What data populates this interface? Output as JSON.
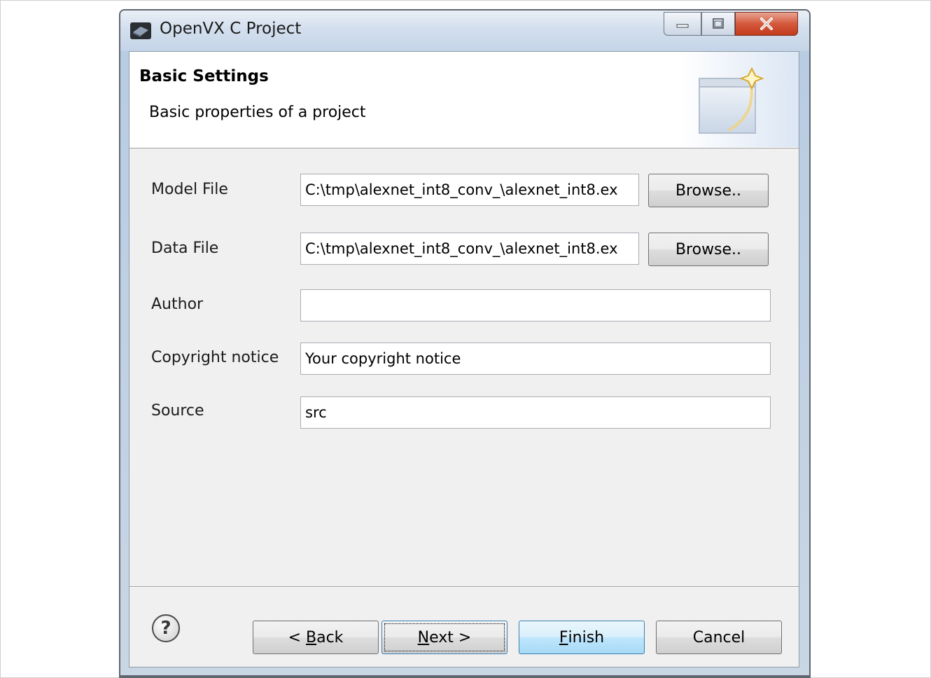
{
  "window": {
    "title": "OpenVX C Project"
  },
  "banner": {
    "title": "Basic Settings",
    "subtitle": "Basic properties of a project"
  },
  "form": {
    "model_file": {
      "label": "Model File",
      "value": "C:\\tmp\\alexnet_int8_conv_\\alexnet_int8.ex",
      "button": "Browse.."
    },
    "data_file": {
      "label": "Data File",
      "value": "C:\\tmp\\alexnet_int8_conv_\\alexnet_int8.ex",
      "button": "Browse.."
    },
    "author": {
      "label": "Author",
      "value": ""
    },
    "copyright": {
      "label": "Copyright notice",
      "value": "Your copyright notice"
    },
    "source": {
      "label": "Source",
      "value": "src"
    }
  },
  "footer": {
    "help_glyph": "?",
    "back": {
      "prefix": "< ",
      "mnemonic": "B",
      "rest": "ack"
    },
    "next": {
      "mnemonic": "N",
      "rest": "ext >"
    },
    "finish": {
      "mnemonic": "F",
      "rest": "inish"
    },
    "cancel": "Cancel"
  },
  "icons": {
    "app": "openvx-app-icon",
    "minimize": "minimize-icon",
    "maximize": "maximize-icon",
    "close": "close-icon",
    "wizard": "wizard-banner-icon",
    "help": "help-icon"
  },
  "colors": {
    "close_button": "#c43a1c",
    "default_button_border": "#3c7fb1",
    "dialog_bg": "#f0f0f0"
  }
}
